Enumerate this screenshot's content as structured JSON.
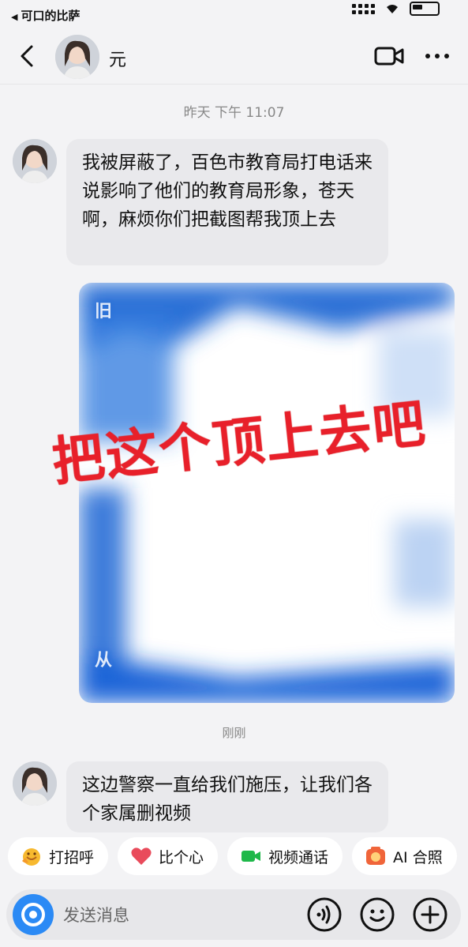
{
  "status_bar": {
    "back_app": "可口的比萨"
  },
  "header": {
    "contact_name": "元"
  },
  "conversation": {
    "timestamp_1": "昨天 下午 11:07",
    "message_1": "我被屏蔽了，百色市教育局打电话来说影响了他们的教育局形象，苍天啊，麻烦你们把截图帮我顶上去",
    "overlay_caption": "把这个顶上去吧",
    "timestamp_2": "刚刚",
    "message_2": "这边警察一直给我们施压，让我们各个家属删视频"
  },
  "quick_actions": [
    {
      "label": "打招呼",
      "icon": "wave-hand-icon"
    },
    {
      "label": "比个心",
      "icon": "heart-icon"
    },
    {
      "label": "视频通话",
      "icon": "video-camera-icon"
    },
    {
      "label": "AI 合照",
      "icon": "ai-photo-icon"
    }
  ],
  "input": {
    "placeholder": "发送消息"
  },
  "colors": {
    "accent": "#2b8af5",
    "overlay_red": "#e8202a",
    "heart": "#e94b5b",
    "video_green": "#1fb84a"
  }
}
